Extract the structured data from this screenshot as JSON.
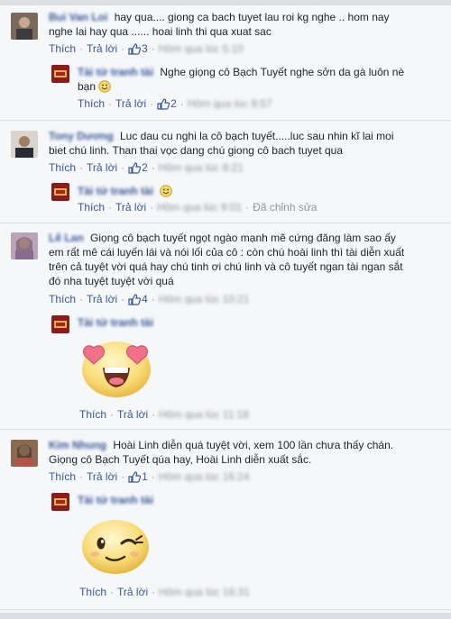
{
  "labels": {
    "like": "Thích",
    "reply": "Trả lời",
    "dot": "·"
  },
  "comments": [
    {
      "name": "Bui Van Loi",
      "text": "hay qua.... giong ca bach tuyet lau roi kg nghe .. hom nay nghe lai hay qua ...... hoai linh thi qua xuat sac",
      "likes": "3",
      "time": "Hôm qua lúc 5:10",
      "reply": {
        "name": "Tài tử tranh tài",
        "text": "Nghe giọng cô Bạch Tuyết nghe sởn da gà luôn nè bạn",
        "likes": "2",
        "time": "Hôm qua lúc 8:57"
      }
    },
    {
      "name": "Tony Dương",
      "text": "Luc dau cu nghi la cô bạch tuyết.....luc sau nhin kĩ lai moi biet chú linh. Than thai vọc dang chú giong cô bach tuyet qua",
      "likes": "2",
      "time": "Hôm qua lúc 8:21",
      "reply": {
        "name": "Tài tử tranh tài",
        "time": "Hôm qua lúc 9:01",
        "edited": "Đã chỉnh sửa"
      }
    },
    {
      "name": "Lê Lan",
      "text": "Giọng cô bạch tuyết ngọt ngào mạnh mẽ cứng đăng làm sao ấy em rất mê cái luyến lái và nói lối của cô : còn chú hoài linh thì tài diễn xuất trên cả tuyệt vời quá hay chú tinh ơi chú linh và cô tuyết ngan tài ngan sắt đó nha tuyệt tuyệt vời quá",
      "likes": "4",
      "time": "Hôm qua lúc 10:21",
      "reply": {
        "name": "Tài tử tranh tài",
        "time": "Hôm qua lúc 11:18"
      }
    },
    {
      "name": "Kim Nhung",
      "text": "Hoài Linh diễn quá tuyệt vời, xem 100 lần chưa thấy chán. Giọng cô Bạch Tuyết qúa hay, Hoài Linh diễn xuất sắc.",
      "likes": "1",
      "time": "Hôm qua lúc 16:24",
      "reply": {
        "name": "Tài tử tranh tài",
        "time": "Hôm qua lúc 16:31"
      }
    }
  ],
  "colors": {
    "link": "#365899",
    "muted": "#90949c",
    "text": "#1d2129",
    "background": "#f6f7f9"
  },
  "icons": [
    "thumbs-up-icon",
    "smiley-icon",
    "heart-eyes-sticker",
    "wink-sticker"
  ]
}
